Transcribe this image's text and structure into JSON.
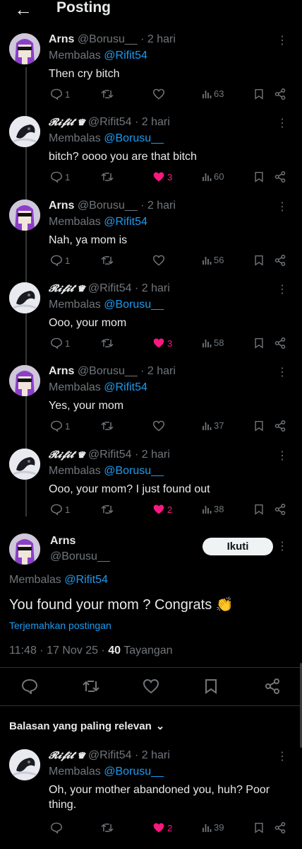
{
  "header": {
    "back_icon": "arrow-left-icon",
    "title": "Posting"
  },
  "replies": [
    {
      "name": "Arns",
      "handle": "@Borusu__",
      "time": "· 2 hari",
      "reply_prefix": "Membalas",
      "reply_to": "@Rifit54",
      "text": "Then cry bitch",
      "replies": "1",
      "likes": "",
      "views": "63",
      "liked": false,
      "avatar": "arns"
    },
    {
      "name": "𝓡𝓲𝓯𝓲𝓽 ♛",
      "handle": "@Rifit54",
      "time": "· 2 hari",
      "reply_prefix": "Membalas",
      "reply_to": "@Borusu__",
      "text": "bitch? oooo you are that bitch",
      "replies": "1",
      "likes": "3",
      "views": "60",
      "liked": true,
      "avatar": "rifit"
    },
    {
      "name": "Arns",
      "handle": "@Borusu__",
      "time": "· 2 hari",
      "reply_prefix": "Membalas",
      "reply_to": "@Rifit54",
      "text": "Nah, ya mom is",
      "replies": "1",
      "likes": "",
      "views": "56",
      "liked": false,
      "avatar": "arns"
    },
    {
      "name": "𝓡𝓲𝓯𝓲𝓽 ♛",
      "handle": "@Rifit54",
      "time": "· 2 hari",
      "reply_prefix": "Membalas",
      "reply_to": "@Borusu__",
      "text": "Ooo, your mom",
      "replies": "1",
      "likes": "3",
      "views": "58",
      "liked": true,
      "avatar": "rifit"
    },
    {
      "name": "Arns",
      "handle": "@Borusu__",
      "time": "· 2 hari",
      "reply_prefix": "Membalas",
      "reply_to": "@Rifit54",
      "text": "Yes, your mom",
      "replies": "1",
      "likes": "",
      "views": "37",
      "liked": false,
      "avatar": "arns"
    },
    {
      "name": "𝓡𝓲𝓯𝓲𝓽 ♛",
      "handle": "@Rifit54",
      "time": "· 2 hari",
      "reply_prefix": "Membalas",
      "reply_to": "@Borusu__",
      "text": "Ooo, your mom? I just found out",
      "replies": "1",
      "likes": "2",
      "views": "38",
      "liked": true,
      "avatar": "rifit"
    }
  ],
  "main": {
    "name": "Arns",
    "handle": "@Borusu__",
    "follow_label": "Ikuti",
    "reply_prefix": "Membalas",
    "reply_to": "@Rifit54",
    "text": "You found your mom ? Congrats 👏",
    "translate": "Terjemahkan postingan",
    "timestamp": "11:48 · 17 Nov 25 · ",
    "views_count": "40",
    "views_label": " Tayangan"
  },
  "relevant_label": "Balasan yang paling relevan",
  "bottom_reply": {
    "name": "𝓡𝓲𝓯𝓲𝓽 ♛",
    "handle": "@Rifit54",
    "time": "· 2 hari",
    "reply_prefix": "Membalas",
    "reply_to": "@Borusu__",
    "text": "Oh, your mother abandoned you, huh? Poor thing.",
    "replies": "",
    "likes": "2",
    "views": "39",
    "liked": true,
    "avatar": "rifit"
  },
  "colors": {
    "accent": "#1d9bf0",
    "like": "#f91880",
    "muted": "#71767b",
    "text": "#e7e9ea",
    "bg": "#000000"
  }
}
